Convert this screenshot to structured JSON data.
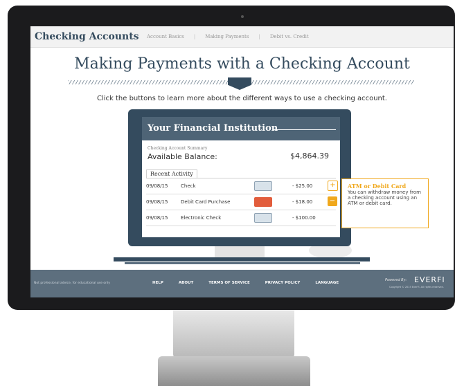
{
  "nav": {
    "brand": "Checking Accounts",
    "links": [
      "Account Basics",
      "Making Payments",
      "Debit vs. Credit"
    ]
  },
  "page": {
    "heading": "Making Payments with a Checking Account",
    "instruction": "Click the buttons to learn more about the different ways to use a checking account."
  },
  "panel": {
    "title": "Your Financial Institution",
    "summary_label": "Checking Account Summary",
    "available_label": "Available Balance:",
    "available_value": "$4,864.39",
    "recent_tab": "Recent Activity",
    "rows": [
      {
        "date": "09/08/15",
        "desc": "Check",
        "amount": "- $25.00",
        "icon": "check-icon",
        "button": "plus"
      },
      {
        "date": "09/08/15",
        "desc": "Debit Card Purchase",
        "amount": "- $18.00",
        "icon": "card-icon",
        "button": "minus"
      },
      {
        "date": "09/08/15",
        "desc": "Electronic Check",
        "amount": "- $100.00",
        "icon": "electronic-check-icon",
        "button": "none"
      }
    ]
  },
  "tooltip": {
    "title": "ATM or Debit Card",
    "body": "You can withdraw money from a checking account using an ATM or debit card."
  },
  "footer": {
    "disclaimer": "Not professional advice, for educational use only",
    "links": [
      "HELP",
      "ABOUT",
      "TERMS OF SERVICE",
      "PRIVACY POLICY",
      "LANGUAGE"
    ],
    "powered_by": "Powered By:",
    "logo": "EVERFI",
    "copyright": "Copyright © 2015 EverFi. All rights reserved."
  },
  "colors": {
    "navy": "#344b5e",
    "accent": "#f0a81c",
    "footer": "#5d6f7e"
  }
}
